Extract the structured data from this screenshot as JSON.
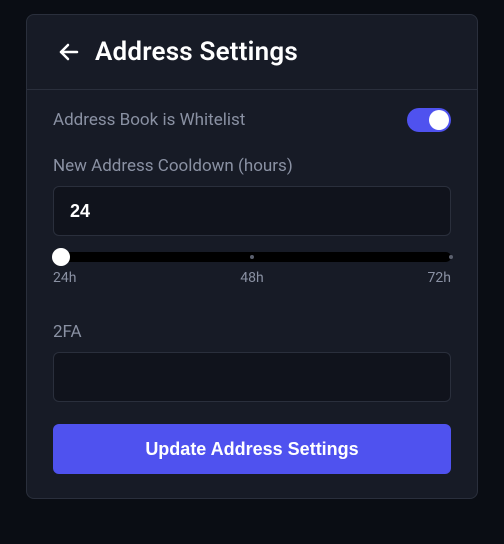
{
  "header": {
    "title": "Address Settings"
  },
  "whitelist": {
    "label": "Address Book is Whitelist",
    "enabled": true
  },
  "cooldown": {
    "label": "New Address Cooldown (hours)",
    "value": "24",
    "slider": {
      "min_label": "24h",
      "mid_label": "48h",
      "max_label": "72h"
    }
  },
  "tfa": {
    "label": "2FA",
    "value": ""
  },
  "submit": {
    "label": "Update Address Settings"
  }
}
